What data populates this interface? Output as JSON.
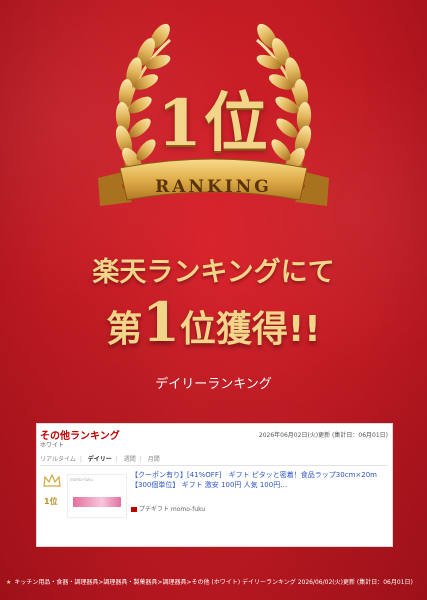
{
  "badge": {
    "number": "1位",
    "ribbon": "RANKING"
  },
  "headline": {
    "line1": "楽天ランキングにて",
    "line2_prefix": "第",
    "line2_number": "1",
    "line2_suffix": "位獲得!!"
  },
  "subhead": "デイリーランキング",
  "panel": {
    "title": "その他ランキング",
    "subtitle": "ホワイト",
    "updated": "2026年06月02日(火)更新 (集計日：06月01日)",
    "tabs": [
      "リアルタイム",
      "デイリー",
      "週間",
      "月間"
    ],
    "active_tab": "デイリー",
    "item": {
      "rank": "1位",
      "thumb_caption": "momo-fuku",
      "title": "【クーポン有り】[41%OFF]　ギフト ピタッと密着！食品ラップ30cm×20m【300個単位】 ギフト 激安 100円 人気 100円…",
      "shop": "プチギフト momo-fuku"
    }
  },
  "footer": {
    "star": "★",
    "text": "キッチン用品・食器・調理器具>調理器具・製菓器具>調理器具>その他 (ホワイト) デイリーランキング 2026/06/02(火)更新 (集計日：06月01日)"
  },
  "colors": {
    "gold": "#f3d58a",
    "rakuten_red": "#bf0000",
    "link_blue": "#2d56c4"
  }
}
